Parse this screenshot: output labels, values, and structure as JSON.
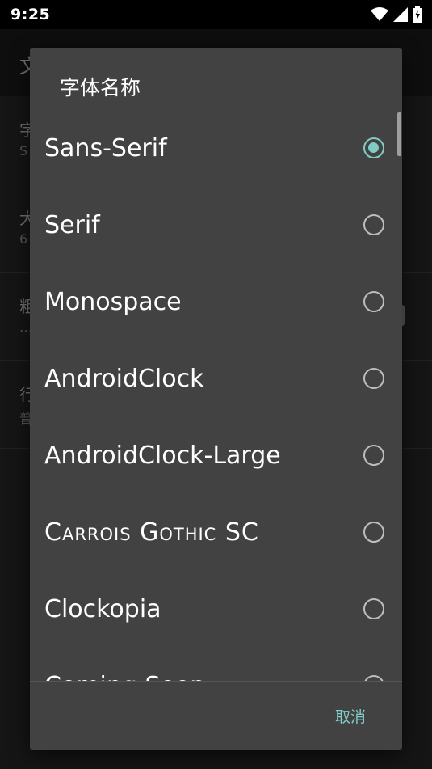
{
  "status_bar": {
    "time": "9:25"
  },
  "background_app": {
    "title": "文",
    "items": [
      {
        "title": "字",
        "summary": "S"
      },
      {
        "title": "大",
        "summary": "6"
      },
      {
        "title": "粗",
        "summary": "…"
      },
      {
        "title": "行",
        "summary": "普"
      }
    ]
  },
  "dialog": {
    "title": "字体名称",
    "options": [
      {
        "label": "Sans-Serif",
        "checked": true
      },
      {
        "label": "Serif",
        "checked": false
      },
      {
        "label": "Monospace",
        "checked": false
      },
      {
        "label": "AndroidClock",
        "checked": false
      },
      {
        "label": "AndroidClock-Large",
        "checked": false
      },
      {
        "label": "Carrois Gothic SC",
        "checked": false
      },
      {
        "label": "Clockopia",
        "checked": false
      },
      {
        "label": "Coming Soon",
        "checked": false
      }
    ],
    "cancel_label": "取消"
  },
  "colors": {
    "accent": "#80cbc4",
    "dialog_bg": "#424242",
    "app_bg": "#303030"
  }
}
